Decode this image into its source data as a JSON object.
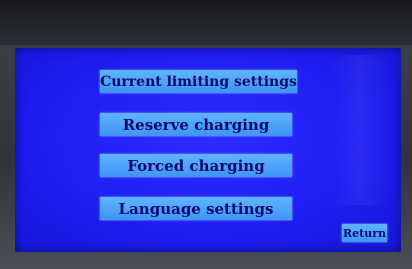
{
  "menu": {
    "current_limiting_label": "Current limiting settings",
    "reserve_charging_label": "Reserve charging",
    "forced_charging_label": "Forced charging",
    "language_settings_label": "Language settings"
  },
  "footer": {
    "return_label": "Return"
  },
  "colors": {
    "screen_background": "#1f1ef4",
    "button_fill": "#4fa4fb",
    "button_text": "#0a0a6a",
    "bezel": "#2a2d33"
  }
}
